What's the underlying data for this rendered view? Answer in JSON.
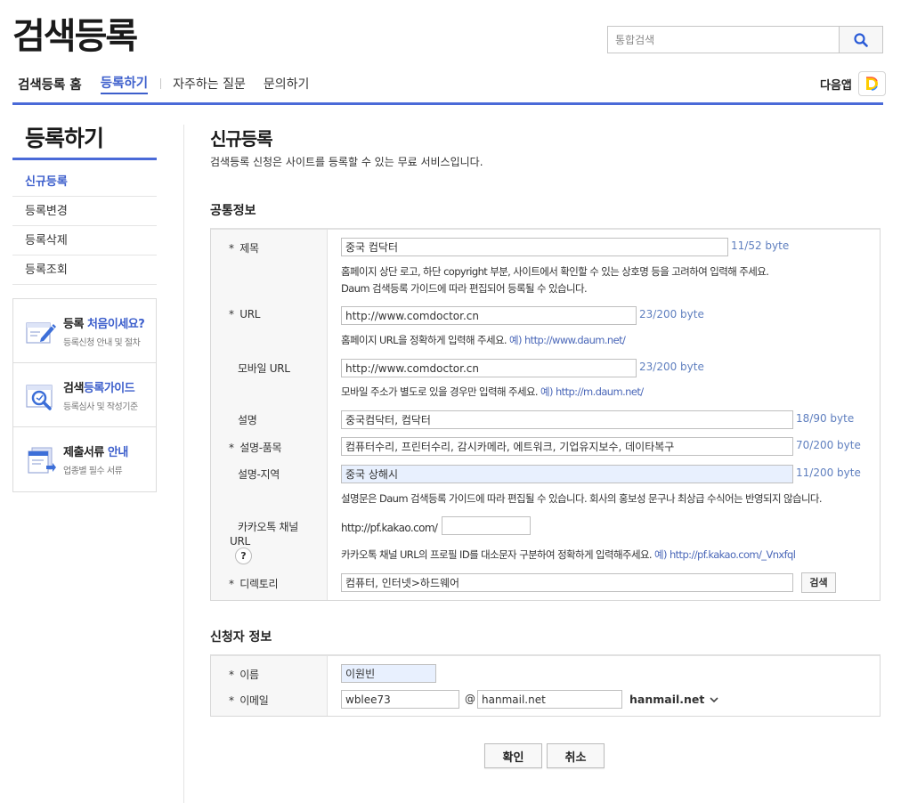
{
  "header": {
    "logo": "검색등록",
    "search_placeholder": "통합검색",
    "nav": {
      "home": "검색등록 홈",
      "register": "등록하기",
      "faq": "자주하는 질문",
      "contact": "문의하기"
    },
    "daum_app": "다음앱",
    "accent": "#4a6ad8"
  },
  "sidebar": {
    "title": "등록하기",
    "items": [
      {
        "label": "신규등록",
        "active": true
      },
      {
        "label": "등록변경",
        "active": false
      },
      {
        "label": "등록삭제",
        "active": false
      },
      {
        "label": "등록조회",
        "active": false
      }
    ],
    "guides": [
      {
        "title_a": "등록 ",
        "title_b": "처음이세요?",
        "sub": "등록신청 안내 및 절차",
        "icon": "pen-icon"
      },
      {
        "title_a": "검색",
        "title_b": "등록가이드",
        "sub": "등록심사 및 작성기준",
        "icon": "magnifier-icon"
      },
      {
        "title_a": "제출서류 ",
        "title_b": "안내",
        "sub": "업종별 필수 서류",
        "icon": "documents-icon"
      }
    ]
  },
  "main": {
    "title": "신규등록",
    "desc": "검색등록 신청은 사이트를 등록할 수 있는 무료 서비스입니다.",
    "common": {
      "section_title": "공통정보",
      "labels": {
        "title": "제목",
        "url": "URL",
        "mobile_url": "모바일 URL",
        "desc": "설명",
        "desc_product": "설명-품목",
        "desc_region": "설명-지역",
        "kakao": "카카오톡 채널",
        "kakao2": "URL",
        "directory": "디렉토리"
      },
      "required_mark": "*",
      "title_value": "중국 컴닥터",
      "title_bytes": "11/52 byte",
      "title_help1": "홈페이지 상단 로고, 하단 copyright 부분, 사이트에서 확인할 수 있는 상호명 등을 고려하여 입력해 주세요.",
      "title_help2": "Daum 검색등록 가이드에 따라 편집되어 등록될 수 있습니다.",
      "url_value": "http://www.comdoctor.cn",
      "url_bytes": "23/200 byte",
      "url_help": "홈페이지 URL을 정확하게 입력해 주세요.",
      "url_example": " 예) http://www.daum.net/",
      "mobile_value": "http://www.comdoctor.cn",
      "mobile_bytes": "23/200 byte",
      "mobile_help": "모바일 주소가 별도로 있을 경우만 입력해 주세요.",
      "mobile_example": " 예) http://m.daum.net/",
      "desc_value": "중국컴닥터, 컴닥터",
      "desc_bytes": "18/90 byte",
      "product_value": "컴퓨터수리, 프린터수리, 감시카메라, 에트워크, 기업유지보수, 데이타복구",
      "product_bytes": "70/200 byte",
      "region_value": "중국 상해시",
      "region_bytes": "11/200 byte",
      "desc_help": "설명문은 Daum 검색등록 가이드에 따라 편집될 수 있습니다. 회사의 홍보성 문구나 최상급 수식어는 반영되지 않습니다.",
      "kakao_prefix": "http://pf.kakao.com/",
      "kakao_value": "",
      "kakao_q": "?",
      "kakao_help": "카카오톡 채널 URL의 프로필 ID를 대소문자 구분하여 정확하게 입력해주세요.",
      "kakao_example": " 예) http://pf.kakao.com/_Vnxfql",
      "directory_value": "컴퓨터, 인터넷>하드웨어",
      "directory_btn": "검색"
    },
    "applicant": {
      "section_title": "신청자 정보",
      "name_label": "이름",
      "email_label": "이메일",
      "name_value": "이원빈",
      "email_id": "wblee73",
      "at": "@",
      "email_domain": "hanmail.net",
      "domain_select": "hanmail.net"
    },
    "buttons": {
      "confirm": "확인",
      "cancel": "취소"
    }
  }
}
